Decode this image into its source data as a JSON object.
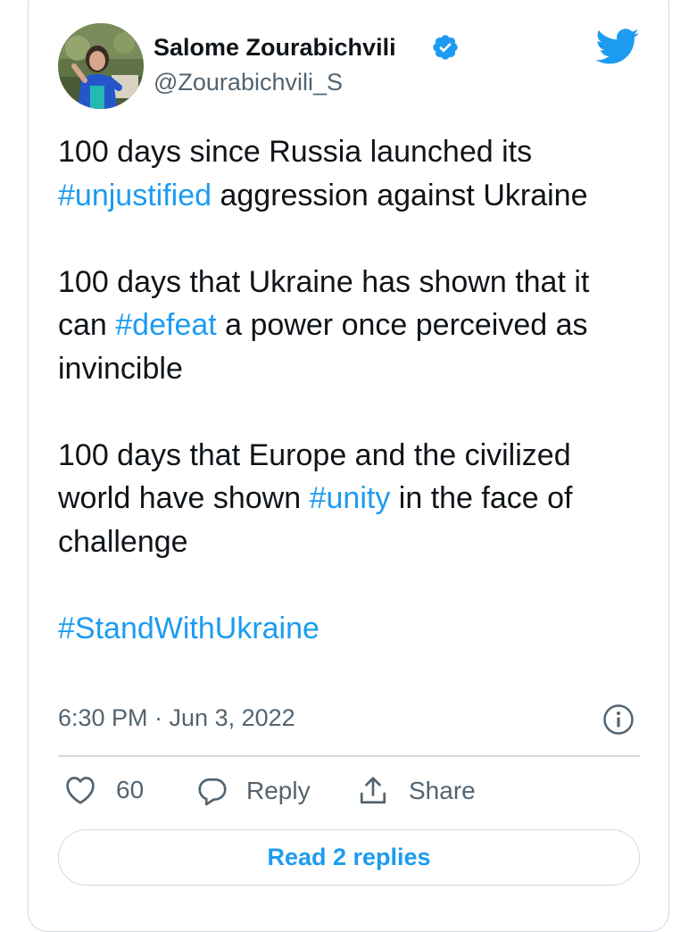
{
  "author": {
    "display_name": "Salome Zourabichvili",
    "handle": "@Zourabichvili_S",
    "verified": true,
    "avatar_icon": "profile-photo"
  },
  "tweet": {
    "paragraphs": [
      [
        {
          "text": "100 days since Russia launched its ",
          "hashtag": false
        },
        {
          "text": "#unjustified",
          "hashtag": true
        },
        {
          "text": " aggression against Ukraine",
          "hashtag": false
        }
      ],
      [
        {
          "text": "100 days that Ukraine has shown that it can ",
          "hashtag": false
        },
        {
          "text": "#defeat",
          "hashtag": true
        },
        {
          "text": " a power once perceived as invincible",
          "hashtag": false
        }
      ],
      [
        {
          "text": "100 days that Europe and the civilized world have shown ",
          "hashtag": false
        },
        {
          "text": "#unity",
          "hashtag": true
        },
        {
          "text": " in the face of challenge",
          "hashtag": false
        }
      ],
      [
        {
          "text": "#StandWithUkraine",
          "hashtag": true
        }
      ]
    ],
    "timestamp": "6:30 PM · Jun 3, 2022"
  },
  "actions": {
    "like_count": "60",
    "reply_label": "Reply",
    "share_label": "Share",
    "read_replies_label": "Read 2 replies"
  },
  "icons": {
    "brand": "twitter-bird-icon",
    "verified": "verified-badge-icon",
    "info": "info-icon",
    "like": "heart-icon",
    "reply": "comment-bubble-icon",
    "share": "share-upload-icon"
  },
  "colors": {
    "accent": "#1d9bf0",
    "text": "#0f1419",
    "secondary": "#536471",
    "border": "#cfd9de"
  }
}
